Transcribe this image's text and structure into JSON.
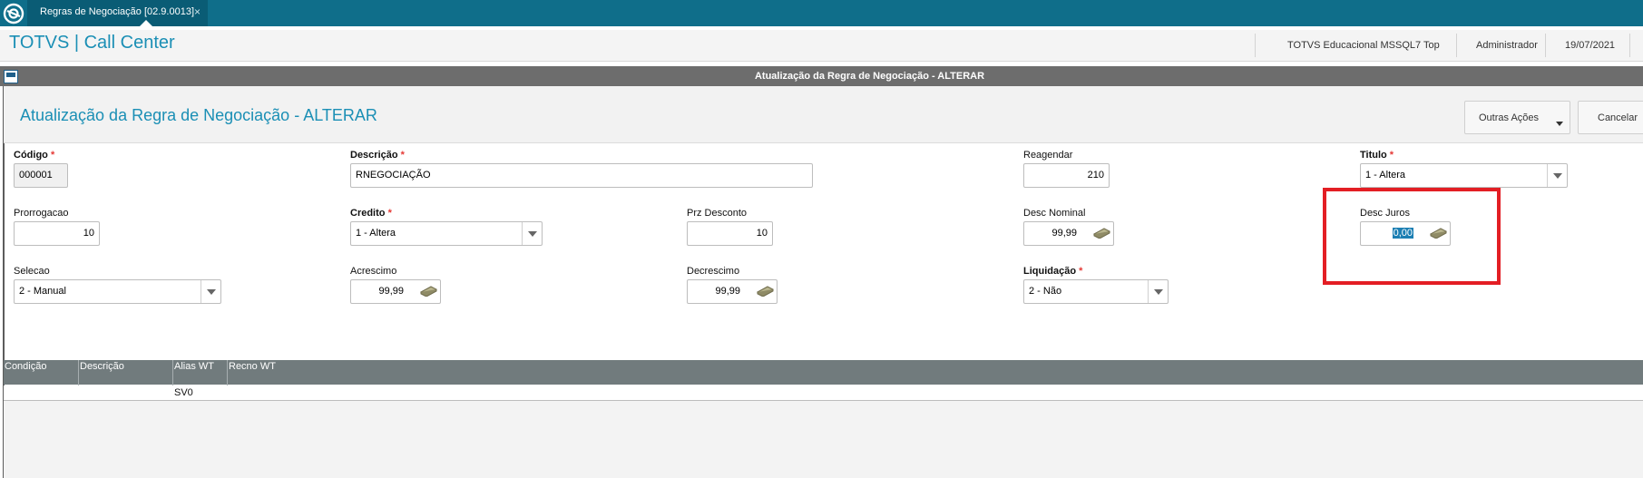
{
  "tab": {
    "label": "Regras de Negociação [02.9.0013]",
    "close": "×"
  },
  "app": {
    "title": "TOTVS | Call Center",
    "environment": "TOTVS Educacional MSSQL7 Top",
    "user": "Administrador",
    "date": "19/07/2021"
  },
  "window": {
    "title": "Atualização da Regra de Negociação - ALTERAR"
  },
  "form": {
    "title": "Atualização da Regra de Negociação - ALTERAR",
    "buttons": {
      "outras": "Outras Ações",
      "cancelar": "Cancelar"
    },
    "required_mark": "*",
    "fields": {
      "codigo": {
        "label": "Código",
        "value": "000001"
      },
      "descricao": {
        "label": "Descrição",
        "value": "RNEGOCIAÇÃO"
      },
      "reagendar": {
        "label": "Reagendar",
        "value": "210"
      },
      "titulo": {
        "label": "Titulo",
        "value": "1 - Altera"
      },
      "prorrogacao": {
        "label": "Prorrogacao",
        "value": "10"
      },
      "credito": {
        "label": "Credito",
        "value": "1 - Altera"
      },
      "prz_desconto": {
        "label": "Prz Desconto",
        "value": "10"
      },
      "desc_nominal": {
        "label": "Desc Nominal",
        "value": "99,99"
      },
      "desc_juros": {
        "label": "Desc Juros",
        "value": "0,00"
      },
      "selecao": {
        "label": "Selecao",
        "value": "2 - Manual"
      },
      "acrescimo": {
        "label": "Acrescimo",
        "value": "99,99"
      },
      "decrescimo": {
        "label": "Decrescimo",
        "value": "99,99"
      },
      "liquidacao": {
        "label": "Liquidação",
        "value": "2 - Não"
      }
    }
  },
  "grid": {
    "columns": [
      "Condição",
      "Descrição",
      "Alias WT",
      "Recno WT"
    ],
    "rows": [
      [
        "",
        "",
        "SV0",
        ""
      ]
    ]
  },
  "colors": {
    "topbar": "#0f6e8a",
    "accent": "#1b8fb5",
    "highlight": "#e31e24",
    "required": "#e53935"
  },
  "icons": {
    "logo": "totvs-logo-icon",
    "money": "money-icon",
    "dropdown": "chevron-down-icon"
  }
}
